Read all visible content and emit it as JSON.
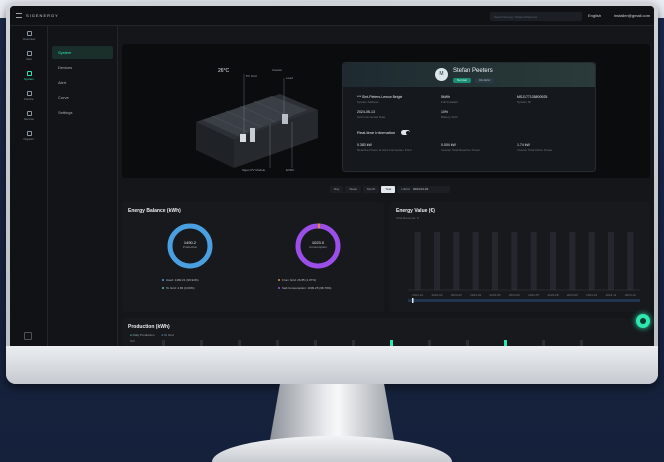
{
  "topbar": {
    "logo": "SIGENERGY",
    "search_placeholder": "Search Energy Stations/Devices",
    "language": "English",
    "user_email": "installer@gmail.com"
  },
  "rail": {
    "items": [
      {
        "label": "Overview",
        "icon": "dashboard-icon"
      },
      {
        "label": "User",
        "icon": "user-icon"
      },
      {
        "label": "System",
        "icon": "system-icon",
        "active": true
      },
      {
        "label": "Device",
        "icon": "device-icon"
      },
      {
        "label": "Service",
        "icon": "service-icon"
      },
      {
        "label": "Organiz.",
        "icon": "organization-icon"
      }
    ]
  },
  "breadcrumb": {
    "parent": "Stad",
    "current": "Stefan Peeters"
  },
  "subnav": {
    "items": [
      {
        "label": "System",
        "active": true
      },
      {
        "label": "Devices"
      },
      {
        "label": "Alert"
      },
      {
        "label": "Curve"
      },
      {
        "label": "Settings"
      }
    ]
  },
  "hero": {
    "temperature": "26°C",
    "callouts": [
      "PV Grid",
      "Inverter",
      "Load",
      "Sigen PV Module",
      "EVDC"
    ]
  },
  "system_card": {
    "avatar": "M",
    "name": "Stefan Peeters",
    "status_tags": [
      "Normal",
      "On-Grid"
    ],
    "fields": [
      {
        "value": "*** Sint-Pieters-Leeuw Belgie",
        "key": "System Address"
      },
      {
        "value": "5kWh",
        "key": "Full Installed"
      },
      {
        "value": "MSJ177135800925",
        "key": "System ID"
      },
      {
        "value": "2024-05-13",
        "key": "Grid-Connected Date"
      },
      {
        "value": "10%",
        "key": "Battery SOC"
      }
    ],
    "realtime_label": "Real-time Information",
    "realtime": [
      {
        "value": "0.383 kW",
        "key": "Reactive Power at Grid Connection Point"
      },
      {
        "value": "0.004 kW",
        "key": "Inverter Total Reactive Power"
      },
      {
        "value": "1.74 kW",
        "key": "Inverter Total Active Power"
      }
    ]
  },
  "time_range": {
    "options": [
      "Day",
      "Week",
      "Month",
      "Year",
      "Lifetime"
    ],
    "selected": "Year",
    "date": "2024-01-01"
  },
  "energy_balance": {
    "title": "Energy Balance (kWh)",
    "production": {
      "value": "1490.2",
      "label": "Production",
      "color": "#4a9fe0"
    },
    "consumption": {
      "value": "1023.0",
      "label": "Consumption",
      "color": "#9b4ee8"
    },
    "production_legend": [
      {
        "label": "Used: 1490.21 (99.94%)",
        "color": "#4a9fe0"
      },
      {
        "label": "To Grid: 4.83 (0.06%)",
        "color": "#57c0a8"
      }
    ],
    "consumption_legend": [
      {
        "label": "From Grid: 26.85 (1.07%)",
        "color": "#e58a3a"
      },
      {
        "label": "Self-Consumption: 1009.25 (98.79%)",
        "color": "#9b4ee8"
      }
    ]
  },
  "energy_value": {
    "title": "Energy Value (€)",
    "subtitle": "Total Revenue: 0",
    "months": [
      "2024-01",
      "2024-02",
      "2024-03",
      "2024-04",
      "2024-05",
      "2024-06",
      "2024-07",
      "2024-08",
      "2024-09",
      "2024-10",
      "2024-11",
      "2024-12"
    ]
  },
  "production_chart": {
    "title": "Production (kWh)",
    "legend": [
      "Daily Production",
      "To Grid"
    ],
    "y_top": "500"
  }
}
